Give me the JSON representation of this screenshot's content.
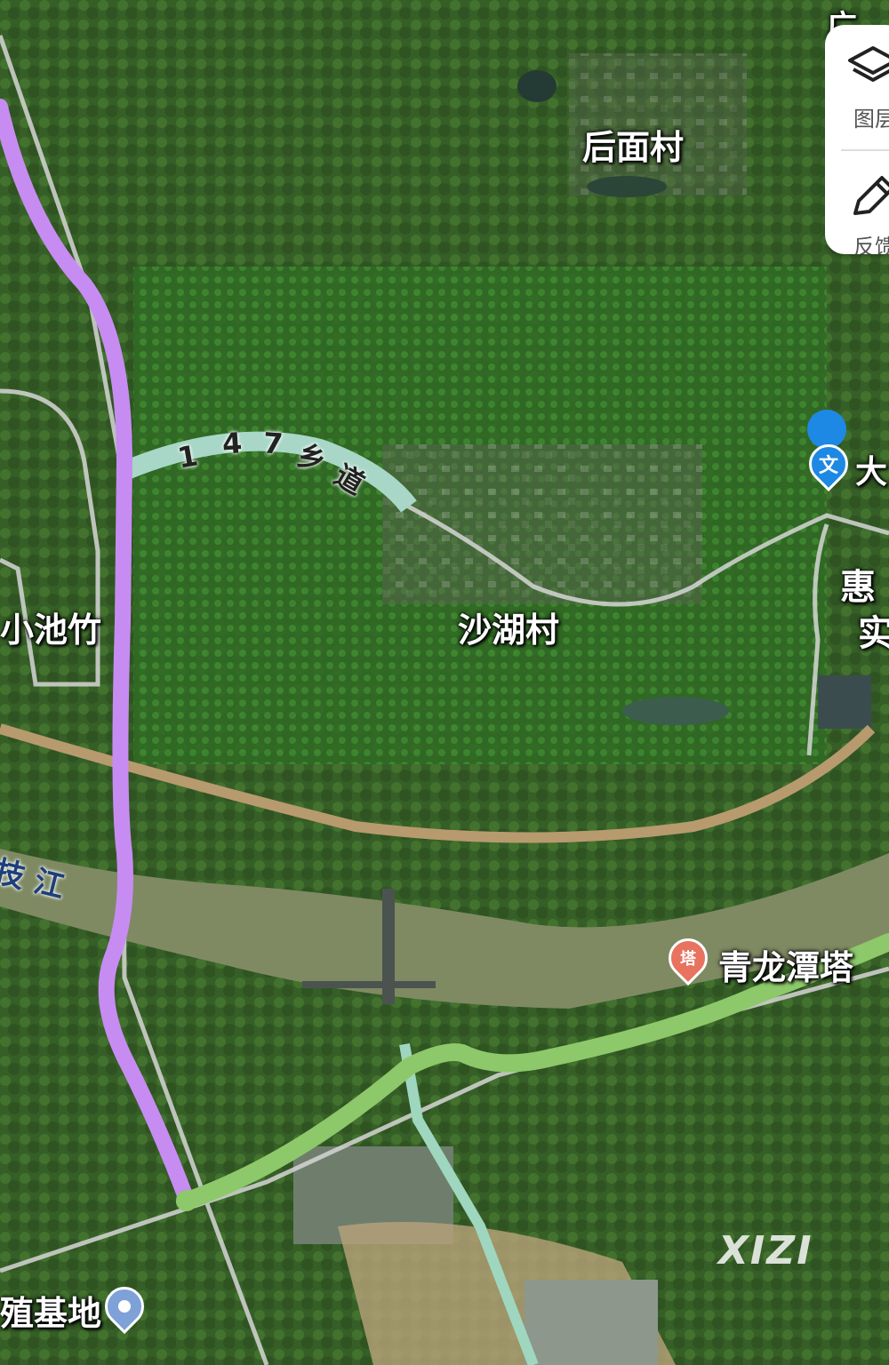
{
  "places": {
    "houmian": "后面村",
    "shahu": "沙湖村",
    "chizhu": "小池竹",
    "qinglongtan": "青龙潭塔",
    "base": "殖基地",
    "huiCut": "惠",
    "shiCut": "实",
    "daCut": "大",
    "topCut": "广"
  },
  "road": {
    "chars": [
      "1",
      "4",
      "7",
      "乡",
      "道"
    ]
  },
  "river": {
    "name": "技 江"
  },
  "panel": {
    "layers_label": "图层",
    "feedback_label": "反馈"
  },
  "pins": {
    "culture_glyph": "文",
    "tower_glyph": "塔"
  },
  "watermark": "XIZI",
  "colors": {
    "purple_route": "#c78cf2",
    "green_route": "#8dc86a",
    "road": "#d9d9d9",
    "river": "#7f8a63"
  }
}
